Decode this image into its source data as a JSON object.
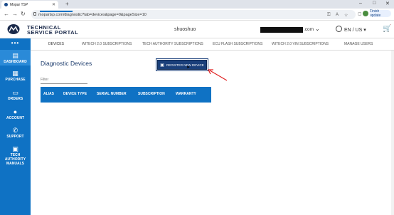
{
  "browser": {
    "tab_title": "Mopar TSP",
    "new_tab": "+",
    "url": "mopartsp.com/diagnostic?tab=devices&page=0&pageSize=10",
    "finish_update": "Finish update",
    "min": "–",
    "max": "□",
    "close": "✕"
  },
  "header": {
    "logo_line1": "TECHNICAL",
    "logo_line2": "SERVICE PORTAL",
    "username": "shuoshuo",
    "email_suffix": ".com",
    "language": "EN / US"
  },
  "sidebar": {
    "more": "•••",
    "items": [
      {
        "label": "DASHBOARD",
        "icon": "dashboard-icon"
      },
      {
        "label": "PURCHASE",
        "icon": "purchase-icon"
      },
      {
        "label": "ORDERS",
        "icon": "orders-icon"
      },
      {
        "label": "ACCOUNT",
        "icon": "account-icon"
      },
      {
        "label": "SUPPORT",
        "icon": "support-icon"
      },
      {
        "label": "TECH",
        "label2": "AUTHORITY",
        "label3": "MANUALS",
        "icon": "manuals-icon"
      }
    ]
  },
  "subnav": {
    "tabs": [
      "DEVICES",
      "WITECH 2.0 SUBSCRIPTIONS",
      "TECH AUTHORITY SUBSCRIPTIONS",
      "ECU FLASH SUBSCRIPTIONS",
      "WITECH 2.0 VIN SUBSCRIPTIONS",
      "MANAGE USERS"
    ],
    "active": "DEVICES"
  },
  "main": {
    "title": "Diagnostic Devices",
    "register_button": "REGISTER NEW DEVICE",
    "filter_placeholder": "Filter",
    "columns": [
      "ALIAS",
      "DEVICE TYPE",
      "SERIAL NUMBER",
      "SUBSCRIPTION",
      "WARRANTY"
    ]
  },
  "colors": {
    "sidebar": "#0f72c4",
    "button": "#1a3f7a",
    "annotation_arrow": "#e02020"
  }
}
